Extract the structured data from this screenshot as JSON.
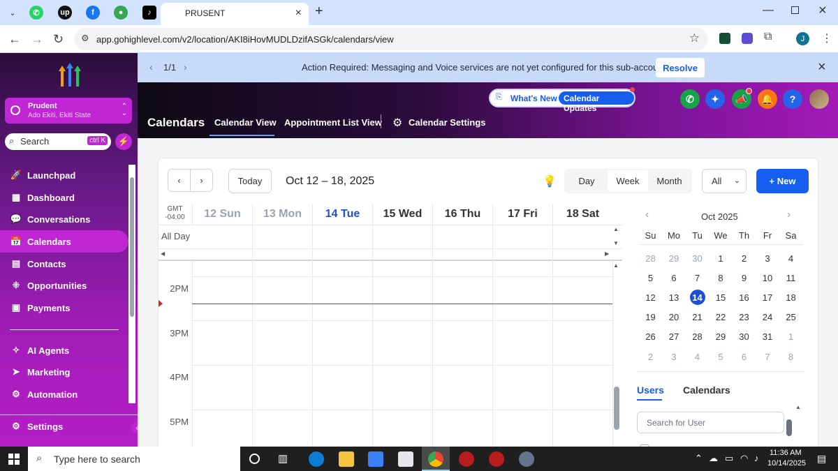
{
  "browser": {
    "tab_title": "PRUSENT",
    "url": "app.gohighlevel.com/v2/location/AKI8iHovMUDLDzifASGk/calendars/view",
    "profile_initial": "J"
  },
  "sidebar": {
    "account_name": "Prudent",
    "account_location": "Ado Ekiti, Ekiti State",
    "search_label": "Search",
    "search_shortcut": "ctrl K",
    "items": [
      {
        "label": "Launchpad"
      },
      {
        "label": "Dashboard"
      },
      {
        "label": "Conversations"
      },
      {
        "label": "Calendars"
      },
      {
        "label": "Contacts"
      },
      {
        "label": "Opportunities"
      },
      {
        "label": "Payments"
      },
      {
        "label": "AI Agents"
      },
      {
        "label": "Marketing"
      },
      {
        "label": "Automation"
      },
      {
        "label": "Settings"
      }
    ]
  },
  "banner": {
    "pager": "1/1",
    "message": "Action Required: Messaging and Voice services are not yet configured for this sub-account!",
    "action_label": "Resolve"
  },
  "header": {
    "whats_new": "What's New",
    "calendar_updates": "Calendar Updates",
    "title": "Calendars",
    "tabs": [
      "Calendar View",
      "Appointment List View",
      "Calendar Settings"
    ],
    "help_label": "?"
  },
  "toolbar": {
    "today_label": "Today",
    "date_range": "Oct 12 – 18, 2025",
    "views": [
      "Day",
      "Week",
      "Month"
    ],
    "filter_value": "All",
    "new_label": "+ New"
  },
  "grid": {
    "tz_label": "GMT",
    "tz_offset": "-04:00",
    "all_day_label": "All Day",
    "days": [
      "12 Sun",
      "13 Mon",
      "14 Tue",
      "15 Wed",
      "16 Thu",
      "17 Fri",
      "18 Sat"
    ],
    "times": [
      "2PM",
      "3PM",
      "4PM",
      "5PM"
    ]
  },
  "mini_calendar": {
    "month": "Oct 2025",
    "weekdays": [
      "Su",
      "Mo",
      "Tu",
      "We",
      "Th",
      "Fr",
      "Sa"
    ],
    "weeks": [
      [
        "28",
        "29",
        "30",
        "1",
        "2",
        "3",
        "4"
      ],
      [
        "5",
        "6",
        "7",
        "8",
        "9",
        "10",
        "11"
      ],
      [
        "12",
        "13",
        "14",
        "15",
        "16",
        "17",
        "18"
      ],
      [
        "19",
        "20",
        "21",
        "22",
        "23",
        "24",
        "25"
      ],
      [
        "26",
        "27",
        "28",
        "29",
        "30",
        "31",
        "1"
      ],
      [
        "2",
        "3",
        "4",
        "5",
        "6",
        "7",
        "8"
      ]
    ],
    "selected": "14"
  },
  "right_panel": {
    "tabs": [
      "Users",
      "Calendars"
    ],
    "search_placeholder": "Search for User"
  },
  "taskbar": {
    "search_placeholder": "Type here to search",
    "time": "11:36 AM",
    "date": "10/14/2025"
  },
  "colors": {
    "accent_blue": "#155eef",
    "sidebar_active": "#c026d3",
    "now_line": "#dc2626"
  }
}
